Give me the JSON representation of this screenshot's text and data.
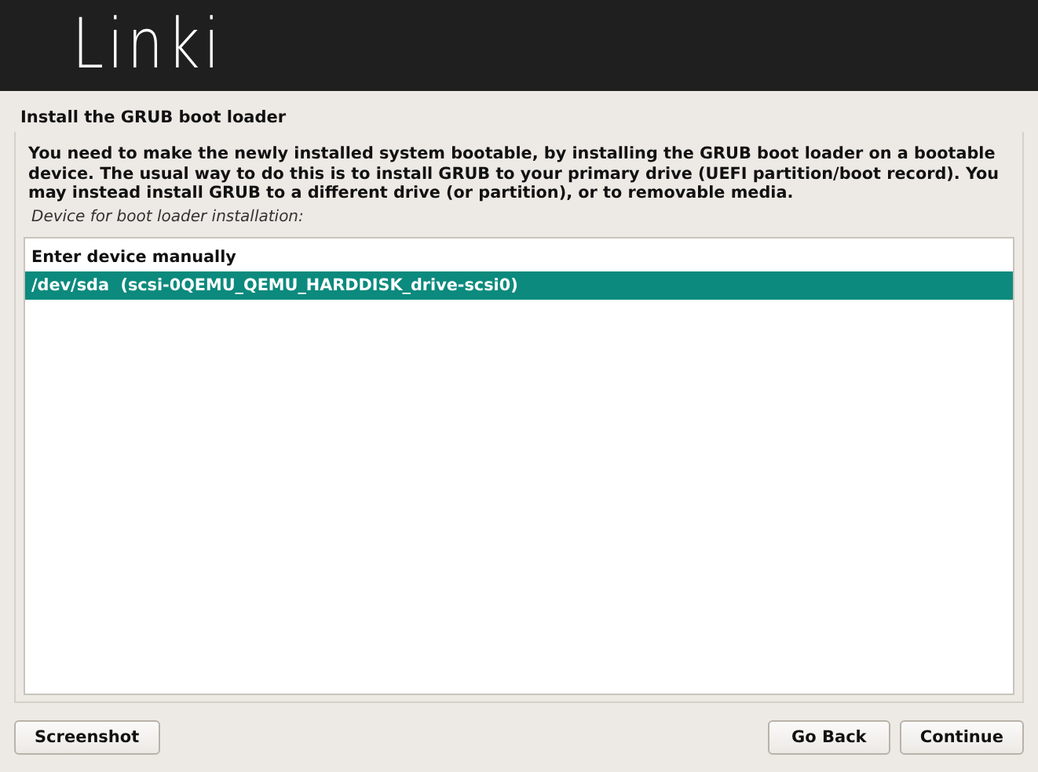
{
  "header": {
    "logo": "Linki"
  },
  "title": "Install the GRUB boot loader",
  "description": "You need to make the newly installed system bootable, by installing the GRUB boot loader on a bootable device. The usual way to do this is to install GRUB to your primary drive (UEFI partition/boot record). You may instead install GRUB to a different drive (or partition), or to removable media.",
  "prompt": "Device for boot loader installation:",
  "devices": [
    {
      "label": "Enter device manually",
      "selected": false
    },
    {
      "label": "/dev/sda  (scsi-0QEMU_QEMU_HARDDISK_drive-scsi0)",
      "selected": true
    }
  ],
  "buttons": {
    "left": [
      "Screenshot"
    ],
    "right": [
      "Go Back",
      "Continue"
    ]
  }
}
